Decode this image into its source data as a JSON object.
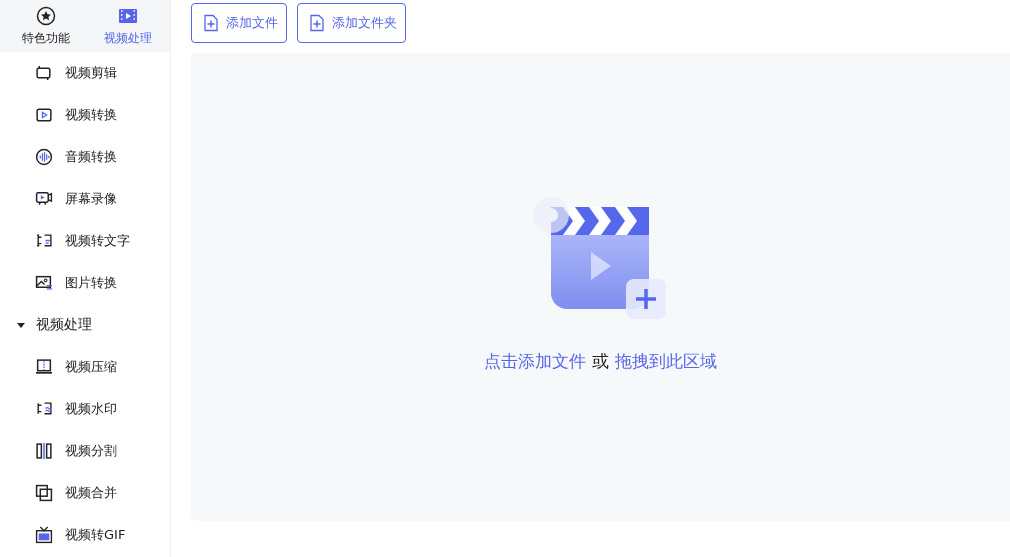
{
  "tabs": [
    {
      "label": "特色功能",
      "selected": false
    },
    {
      "label": "视频处理",
      "selected": true
    }
  ],
  "sidebar": {
    "items": [
      {
        "kind": "item",
        "label": "视频剪辑"
      },
      {
        "kind": "item",
        "label": "视频转换"
      },
      {
        "kind": "item",
        "label": "音频转换"
      },
      {
        "kind": "item",
        "label": "屏幕录像"
      },
      {
        "kind": "item",
        "label": "视频转文字"
      },
      {
        "kind": "item",
        "label": "图片转换"
      },
      {
        "kind": "group",
        "label": "视频处理",
        "expanded": true,
        "children": [
          {
            "kind": "item",
            "label": "视频压缩"
          },
          {
            "kind": "item",
            "label": "视频水印"
          },
          {
            "kind": "item",
            "label": "视频分割"
          },
          {
            "kind": "item",
            "label": "视频合并"
          },
          {
            "kind": "item",
            "label": "视频转GIF"
          }
        ]
      }
    ]
  },
  "toolbar": {
    "buttons": [
      "添加文件",
      "添加文件夹"
    ]
  },
  "drop_zone": {
    "click_text": "点击添加文件",
    "or_text": "或",
    "drag_text": "拖拽到此区域"
  }
}
